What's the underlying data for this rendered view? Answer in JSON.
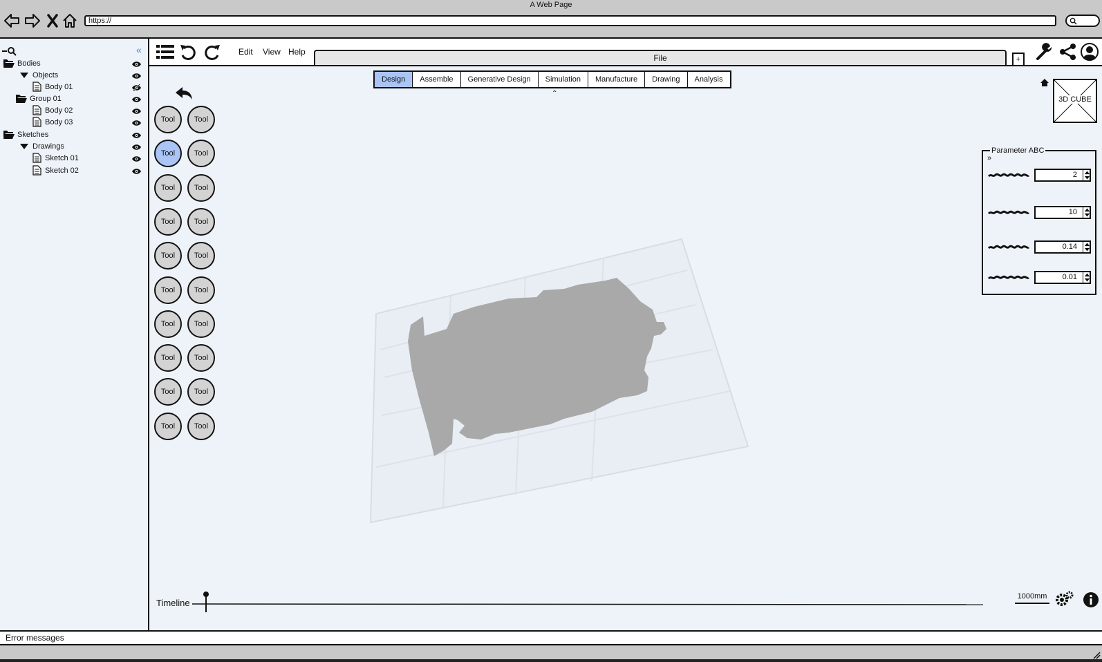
{
  "browser": {
    "title": "A Web Page",
    "url": "https://"
  },
  "sidebar": {
    "tree": [
      {
        "label": "Bodies",
        "icon": "folder-open-icon",
        "visible": true
      },
      {
        "label": "Objects",
        "icon": "triangle-down-icon",
        "visible": true
      },
      {
        "label": "Body 01",
        "icon": "document-icon",
        "visible": false
      },
      {
        "label": "Group 01",
        "icon": "folder-open-icon",
        "visible": true
      },
      {
        "label": "Body 02",
        "icon": "document-icon",
        "visible": true
      },
      {
        "label": "Body 03",
        "icon": "document-icon",
        "visible": true
      },
      {
        "label": "Sketches",
        "icon": "folder-open-icon",
        "visible": true
      },
      {
        "label": "Drawings",
        "icon": "triangle-down-icon",
        "visible": true
      },
      {
        "label": "Sketch 01",
        "icon": "document-icon",
        "visible": true
      },
      {
        "label": "Sketch 02",
        "icon": "document-icon",
        "visible": true
      }
    ]
  },
  "menu": {
    "edit": "Edit",
    "view": "View",
    "help": "Help"
  },
  "file_tab": {
    "label": "File",
    "add": "+"
  },
  "workspaces": [
    {
      "label": "Design",
      "active": true
    },
    {
      "label": "Assemble",
      "active": false
    },
    {
      "label": "Generative Design",
      "active": false
    },
    {
      "label": "Simulation",
      "active": false
    },
    {
      "label": "Manufacture",
      "active": false
    },
    {
      "label": "Drawing",
      "active": false
    },
    {
      "label": "Analysis",
      "active": false
    }
  ],
  "tools": {
    "label": "Tool",
    "active_index": 2,
    "count": 20
  },
  "view_cube": {
    "label": "3D CUBE"
  },
  "parameters": {
    "title": "Parameter ABC",
    "values": [
      "2",
      "10",
      "0.14",
      "0.01"
    ]
  },
  "timeline": {
    "label": "Timeline"
  },
  "scale": "1000mm",
  "status": {
    "message": "Error messages"
  },
  "colors": {
    "accent": "#a9c4f5",
    "canvas": "#eef3f9",
    "model": "#a9a9a9",
    "chrome": "#c9c9c9"
  }
}
